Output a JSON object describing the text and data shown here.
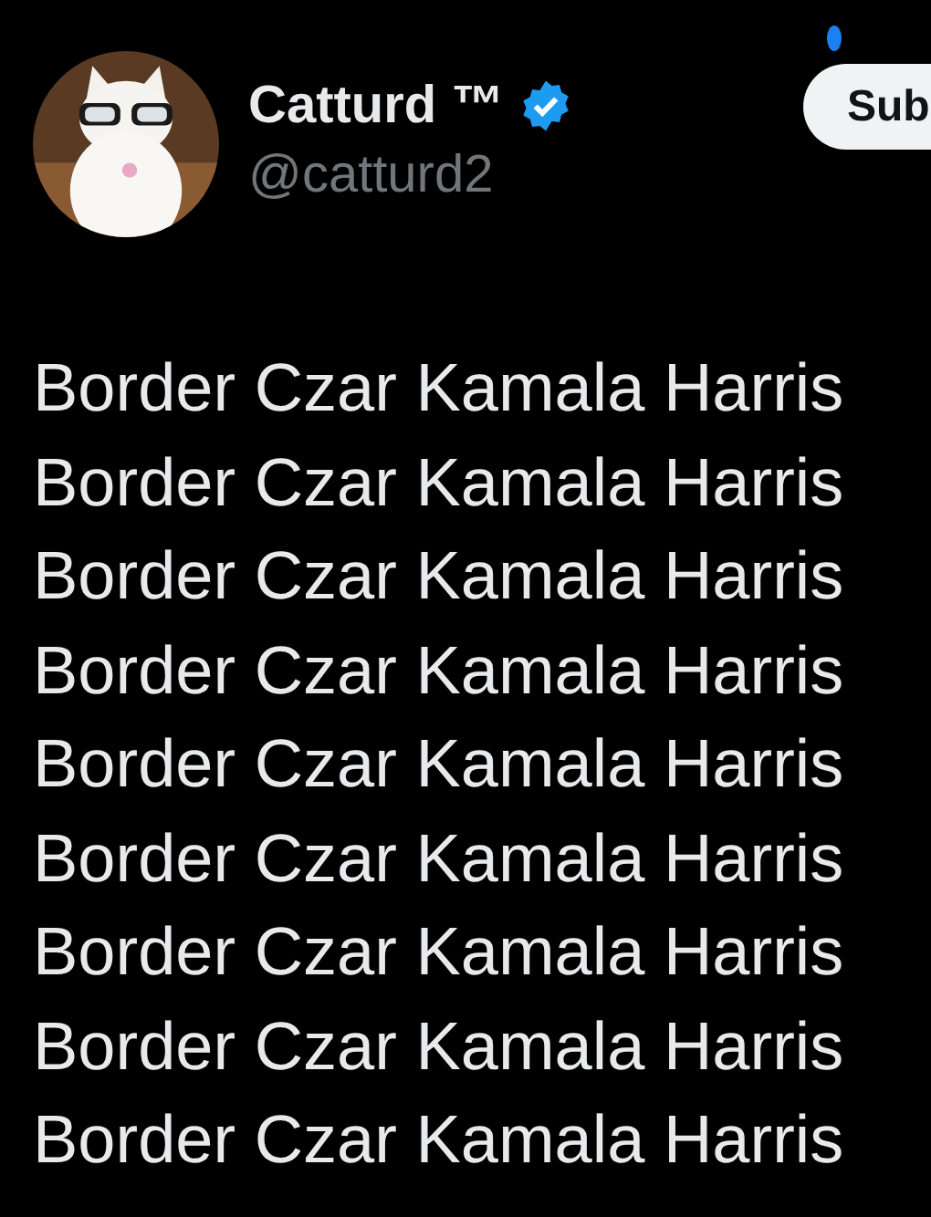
{
  "author": {
    "name": "Catturd ™",
    "verified": true,
    "handle": "@catturd2"
  },
  "subscribe_button": {
    "label": "Sub"
  },
  "tweet_lines": [
    "Border Czar Kamala Harris",
    "Border Czar Kamala Harris",
    "Border Czar Kamala Harris",
    "Border Czar Kamala Harris",
    "Border Czar Kamala Harris",
    "Border Czar Kamala Harris",
    "Border Czar Kamala Harris",
    "Border Czar Kamala Harris",
    "Border Czar Kamala Harris"
  ]
}
